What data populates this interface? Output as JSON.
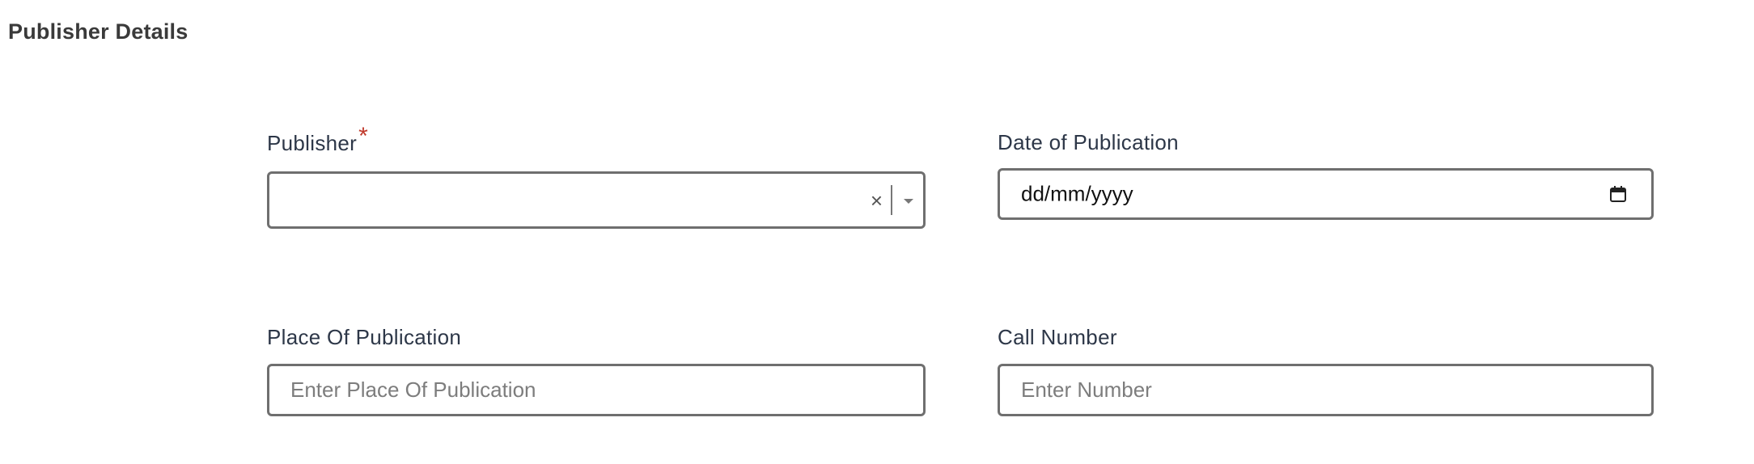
{
  "section": {
    "title": "Publisher Details"
  },
  "fields": {
    "publisher": {
      "label": "Publisher",
      "required_mark": "*",
      "value": "",
      "clear_glyph": "×"
    },
    "date_of_publication": {
      "label": "Date of Publication",
      "placeholder": "dd/mm/yyyy",
      "icon": "calendar-icon"
    },
    "place_of_publication": {
      "label": "Place Of Publication",
      "placeholder": "Enter Place Of Publication"
    },
    "call_number": {
      "label": "Call Number",
      "placeholder": "Enter Number"
    }
  },
  "colors": {
    "required": "#c0392b",
    "border": "#6f6f6f",
    "label": "#2d3748"
  }
}
